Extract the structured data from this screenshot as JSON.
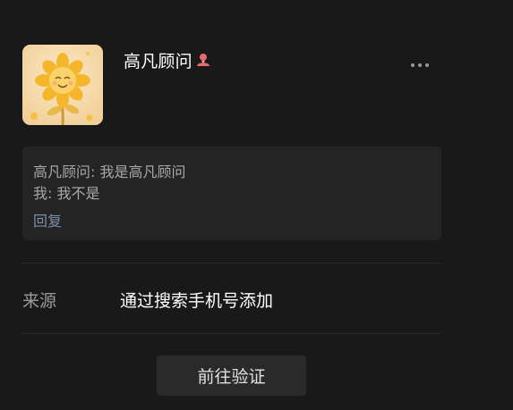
{
  "contact": {
    "name": "高凡顾问",
    "avatar_icon": "sunflower-avatar",
    "gender_icon": "female-icon",
    "gender_color": "#e86b6b"
  },
  "header": {
    "more_icon": "more-dots-icon"
  },
  "message_card": {
    "line1": "高凡顾问: 我是高凡顾问",
    "line2": "我: 我不是",
    "reply_label": "回复"
  },
  "source": {
    "label": "来源",
    "value": "通过搜索手机号添加"
  },
  "actions": {
    "verify_label": "前往验证"
  },
  "colors": {
    "background": "#191919",
    "card": "#242424",
    "link": "#7d90aa",
    "button": "#2a2a2a"
  }
}
